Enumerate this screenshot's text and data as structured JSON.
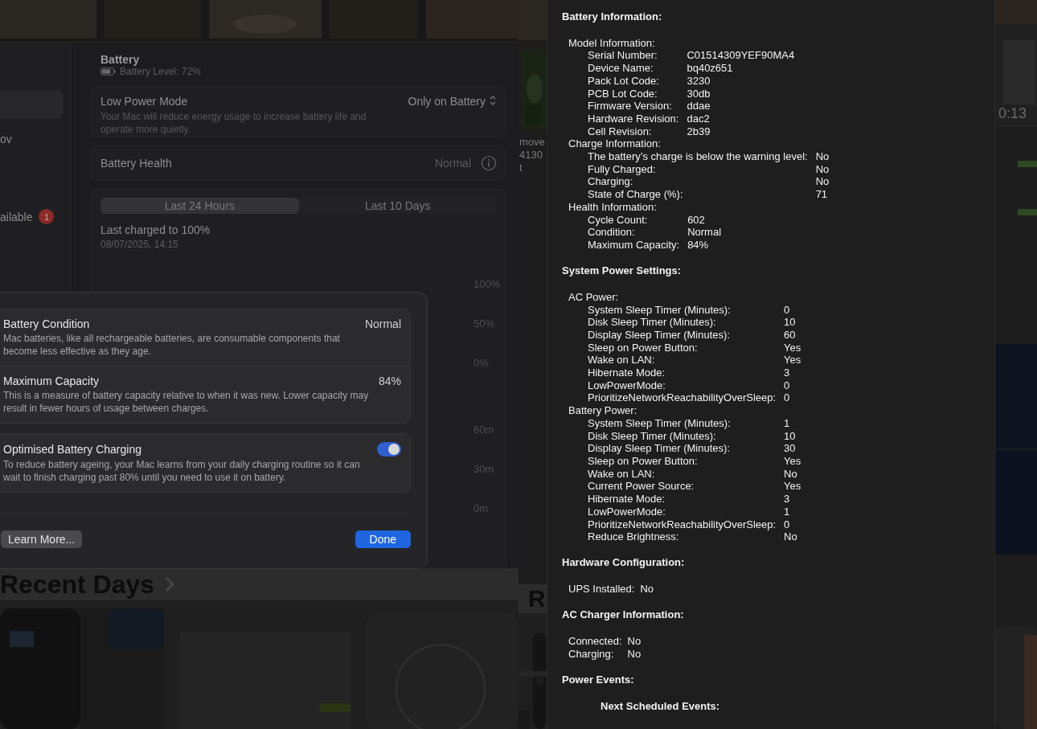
{
  "settings_window": {
    "sidebar": {
      "items": [
        {
          "label": "ov"
        },
        {
          "label": "ailable",
          "badge": "1"
        }
      ]
    },
    "title": "Battery",
    "battery_level": "Battery Level: 72%",
    "low_power_mode": {
      "label": "Low Power Mode",
      "description": "Your Mac will reduce energy usage to increase battery life and operate more quietly.",
      "value": "Only on Battery"
    },
    "battery_health": {
      "label": "Battery Health",
      "value": "Normal"
    },
    "tabs": [
      {
        "label": "Last 24 Hours",
        "selected": true
      },
      {
        "label": "Last 10 Days",
        "selected": false
      }
    ],
    "last_charged": {
      "title": "Last charged to 100%",
      "time": "08/07/2025, 14:15"
    },
    "chart_axis": {
      "upper": [
        "100%",
        "50%",
        "0%"
      ],
      "lower": [
        "60m",
        "30m",
        "0m"
      ]
    }
  },
  "dialog": {
    "items": [
      {
        "kind": "value",
        "title": "Battery Condition",
        "description": "Mac batteries, like all rechargeable batteries, are consumable components that become less effective as they age.",
        "value": "Normal"
      },
      {
        "kind": "value",
        "title": "Maximum Capacity",
        "description": "This is a measure of battery capacity relative to when it was new. Lower capacity may result in fewer hours of usage between charges.",
        "value": "84%"
      },
      {
        "kind": "toggle",
        "title": "Optimised Battery Charging",
        "description": "To reduce battery ageing, your Mac learns from your daily charging routine so it can wait to finish charging past 80% until you need to use it on battery.",
        "on": true
      }
    ],
    "buttons": [
      {
        "label": "Learn More...",
        "kind": "secondary"
      },
      {
        "label": "Done",
        "kind": "primary"
      }
    ]
  },
  "background_page": {
    "heading": "Recent Days",
    "side_texts": [
      "move",
      "4130",
      "t"
    ],
    "side_heading": "R",
    "video_time": "0:13"
  },
  "system_information": {
    "sections": [
      {
        "title": "Battery Information:",
        "groups": [
          {
            "title": "Model Information:",
            "rows": [
              {
                "label": "Serial Number:",
                "value": "C01514309YEF90MA4"
              },
              {
                "label": "Device Name:",
                "value": "bq40z651"
              },
              {
                "label": "Pack Lot Code:",
                "value": "3230"
              },
              {
                "label": "PCB Lot Code:",
                "value": "30db"
              },
              {
                "label": "Firmware Version:",
                "value": "ddae"
              },
              {
                "label": "Hardware Revision:",
                "value": "dac2"
              },
              {
                "label": "Cell Revision:",
                "value": "2b39"
              }
            ]
          },
          {
            "title": "Charge Information:",
            "rows": [
              {
                "label": "The battery’s charge is below the warning level:",
                "value": "No"
              },
              {
                "label": "Fully Charged:",
                "value": "No"
              },
              {
                "label": "Charging:",
                "value": "No"
              },
              {
                "label": "State of Charge (%):",
                "value": "71"
              }
            ]
          },
          {
            "title": "Health Information:",
            "rows": [
              {
                "label": "Cycle Count:",
                "value": "602"
              },
              {
                "label": "Condition:",
                "value": "Normal"
              },
              {
                "label": "Maximum Capacity:",
                "value": "84%"
              }
            ]
          }
        ]
      },
      {
        "title": "System Power Settings:",
        "groups": [
          {
            "title": "AC Power:",
            "rows": [
              {
                "label": "System Sleep Timer (Minutes):",
                "value": "0"
              },
              {
                "label": "Disk Sleep Timer (Minutes):",
                "value": "10"
              },
              {
                "label": "Display Sleep Timer (Minutes):",
                "value": "60"
              },
              {
                "label": "Sleep on Power Button:",
                "value": "Yes"
              },
              {
                "label": "Wake on LAN:",
                "value": "Yes"
              },
              {
                "label": "Hibernate Mode:",
                "value": "3"
              },
              {
                "label": "LowPowerMode:",
                "value": "0"
              },
              {
                "label": "PrioritizeNetworkReachabilityOverSleep:",
                "value": "0"
              }
            ]
          },
          {
            "title": "Battery Power:",
            "rows": [
              {
                "label": "System Sleep Timer (Minutes):",
                "value": "1"
              },
              {
                "label": "Disk Sleep Timer (Minutes):",
                "value": "10"
              },
              {
                "label": "Display Sleep Timer (Minutes):",
                "value": "30"
              },
              {
                "label": "Sleep on Power Button:",
                "value": "Yes"
              },
              {
                "label": "Wake on LAN:",
                "value": "No"
              },
              {
                "label": "Current Power Source:",
                "value": "Yes"
              },
              {
                "label": "Hibernate Mode:",
                "value": "3"
              },
              {
                "label": "LowPowerMode:",
                "value": "1"
              },
              {
                "label": "PrioritizeNetworkReachabilityOverSleep:",
                "value": "0"
              },
              {
                "label": "Reduce Brightness:",
                "value": "No"
              }
            ]
          }
        ]
      },
      {
        "title": "Hardware Configuration:",
        "groups": [
          {
            "rows": [
              {
                "label": "UPS Installed:",
                "value": "No"
              }
            ]
          }
        ]
      },
      {
        "title": "AC Charger Information:",
        "groups": [
          {
            "rows": [
              {
                "label": "Connected:",
                "value": "No"
              },
              {
                "label": "Charging:",
                "value": "No"
              }
            ]
          }
        ]
      },
      {
        "title": "Power Events:",
        "groups": [
          {
            "title": "Next Scheduled Events:",
            "kind": "subheading"
          }
        ]
      }
    ]
  }
}
